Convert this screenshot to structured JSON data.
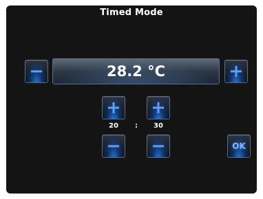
{
  "header": {
    "title": "Timed Mode"
  },
  "temperature": {
    "value": "28.2 °C"
  },
  "timer": {
    "hours": "20",
    "separator": ":",
    "minutes": "30"
  },
  "buttons": {
    "ok_label": "OK"
  },
  "icons": {
    "minus": "minus-icon",
    "plus": "plus-icon"
  },
  "colors": {
    "background": "#141414",
    "accent": "#4a90ff",
    "text": "#ffffff"
  }
}
